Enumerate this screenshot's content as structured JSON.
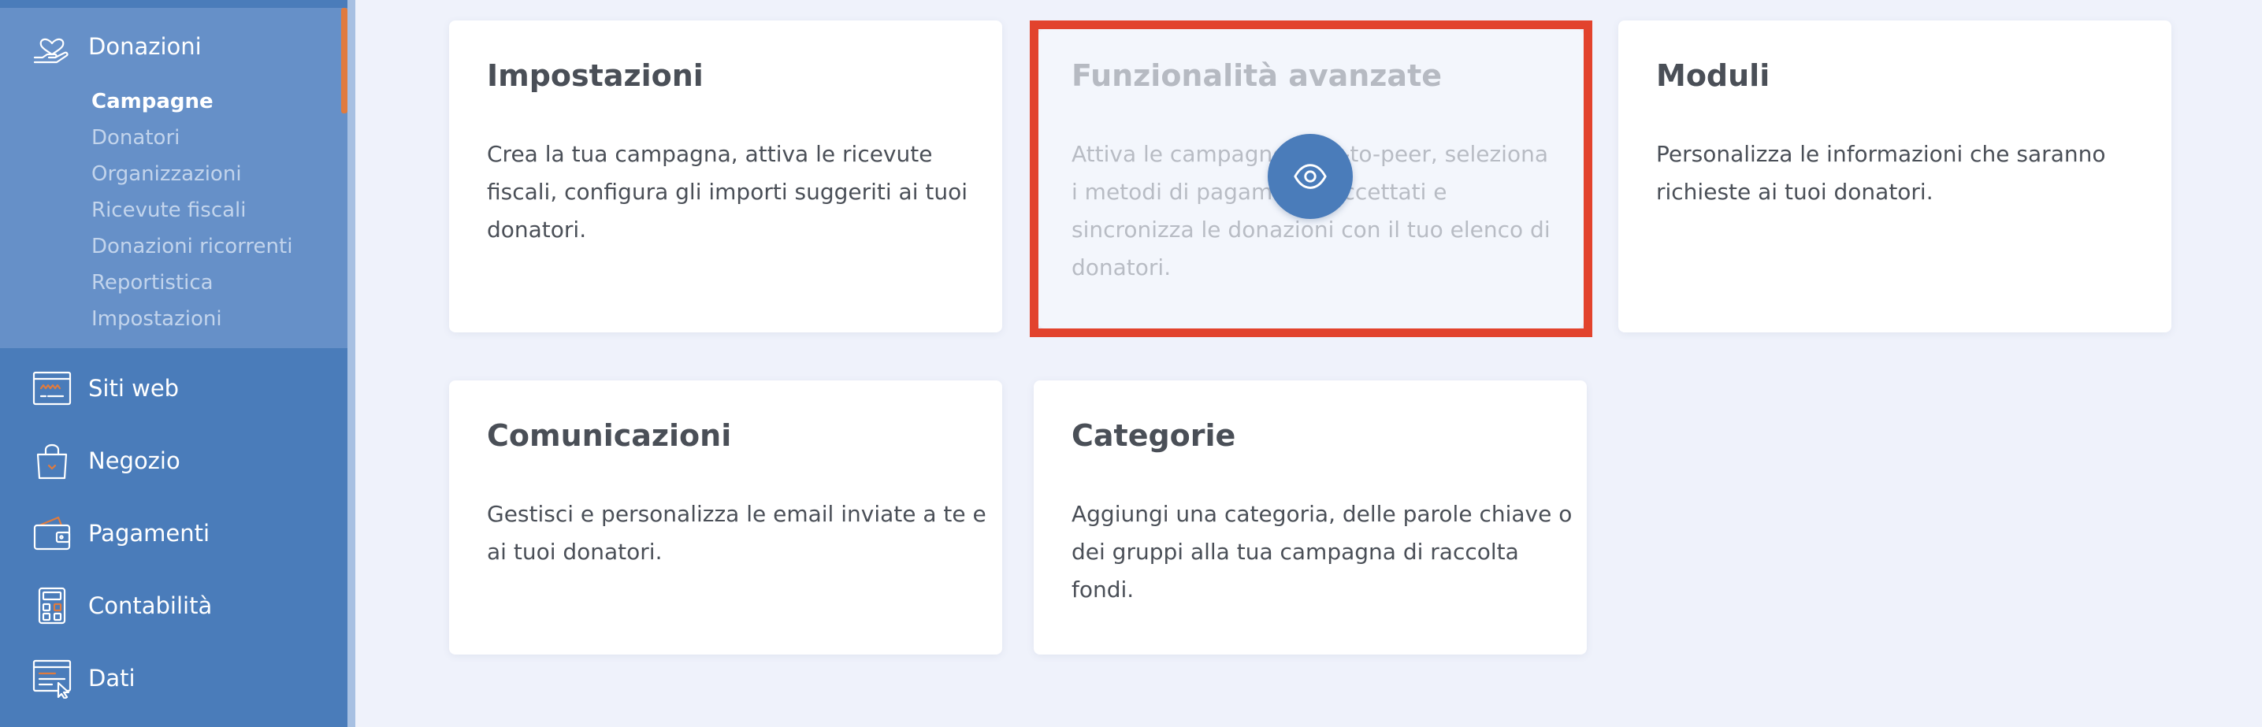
{
  "sidebar": {
    "donazioni": {
      "label": "Donazioni",
      "icon": "heart-hand-icon",
      "sub_items": [
        {
          "label": "Campagne",
          "active": true
        },
        {
          "label": "Donatori",
          "active": false
        },
        {
          "label": "Organizzazioni",
          "active": false
        },
        {
          "label": "Ricevute fiscali",
          "active": false
        },
        {
          "label": "Donazioni ricorrenti",
          "active": false
        },
        {
          "label": "Reportistica",
          "active": false
        },
        {
          "label": "Impostazioni",
          "active": false
        }
      ]
    },
    "items": [
      {
        "label": "Siti web",
        "icon": "browser-window-icon"
      },
      {
        "label": "Negozio",
        "icon": "shopping-bag-icon"
      },
      {
        "label": "Pagamenti",
        "icon": "wallet-icon"
      },
      {
        "label": "Contabilità",
        "icon": "calculator-icon"
      },
      {
        "label": "Dati",
        "icon": "data-table-icon"
      }
    ]
  },
  "cards": [
    {
      "title": "Impostazioni",
      "description": "Crea la tua campagna, attiva le ricevute fiscali, configura gli importi suggeriti ai tuoi donatori."
    },
    {
      "title": "Funzionalità avanzate",
      "description": "Attiva le campagne peer-to-peer, seleziona i metodi di pagamento accettati e sincronizza le donazioni con il tuo elenco di donatori.",
      "disabled": true,
      "highlighted": true,
      "overlay_icon": "eye-icon"
    },
    {
      "title": "Moduli",
      "description": "Personalizza le informazioni che saranno richieste ai tuoi donatori."
    },
    {
      "title": "Comunicazioni",
      "description": "Gestisci e personalizza le email inviate a te e ai tuoi donatori."
    },
    {
      "title": "Categorie",
      "description": "Aggiungi una categoria, delle parole chiave o dei gruppi alla tua campagna di raccolta fondi."
    }
  ],
  "colors": {
    "sidebar": "#4a7cba",
    "sidebar_active_block": "#6690c8",
    "accent": "#e07b3e",
    "highlight_border": "#e2432d",
    "background": "#eff2fb"
  }
}
